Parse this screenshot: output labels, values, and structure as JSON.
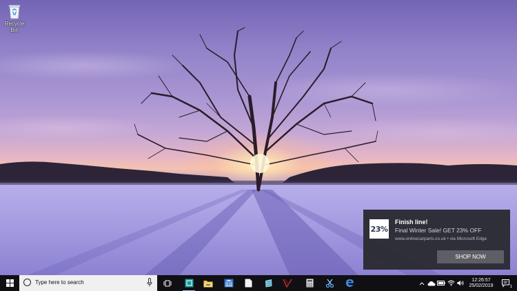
{
  "desktop": {
    "icons": [
      {
        "label": "Recycle Bin",
        "icon": "recycle-bin-icon"
      }
    ]
  },
  "toast": {
    "logo_text": "23%",
    "title": "Finish line!",
    "body": "Final Winter Sale! GET 23% OFF",
    "attribution": "www.onlinecarparts.co.uk • via Microsoft Edge",
    "button_label": "SHOP NOW"
  },
  "taskbar": {
    "start_icon": "windows-logo-icon",
    "search_placeholder": "Type here to search",
    "pinned_apps": [
      "task-view-icon",
      "app-store-icon",
      "file-explorer-icon",
      "control-panel-icon",
      "document-icon",
      "notepad-icon",
      "red-app-icon",
      "calculator-icon",
      "snipping-tool-icon",
      "edge-browser-icon"
    ],
    "tray_icons": [
      "chevron-up-icon",
      "onedrive-cloud-icon",
      "battery-icon",
      "wifi-icon",
      "volume-icon"
    ],
    "time": "12:26:57",
    "date": "25/02/2019",
    "notification_count": "1"
  },
  "colors": {
    "taskbar": "#101014",
    "toast_bg": "#2b2b34",
    "toast_button": "#5e5e66",
    "accent": "#3a8ee6"
  }
}
